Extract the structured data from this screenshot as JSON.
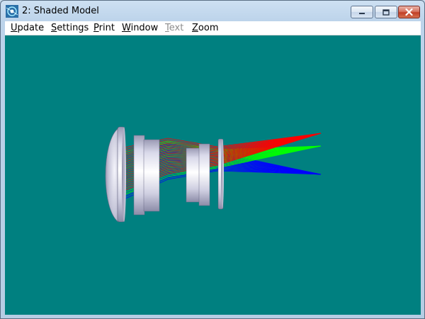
{
  "window": {
    "title": "2: Shaded Model",
    "icon": "lens-app-icon"
  },
  "menubar": {
    "items": [
      {
        "label": "Update",
        "mnemonic": "U",
        "rest": "pdate",
        "enabled": true
      },
      {
        "label": "Settings",
        "mnemonic": "S",
        "rest": "ettings",
        "enabled": true
      },
      {
        "label": "Print",
        "mnemonic": "P",
        "rest": "rint",
        "enabled": true
      },
      {
        "label": "Window",
        "mnemonic": "W",
        "rest": "indow",
        "enabled": true
      },
      {
        "label": "Text",
        "mnemonic": "T",
        "rest": "ext",
        "enabled": false
      },
      {
        "label": "Zoom",
        "mnemonic": "Z",
        "rest": "oom",
        "enabled": true
      }
    ]
  },
  "viewport": {
    "background": "#008080",
    "model": "shaded-lens-assembly",
    "ray_colors": [
      "#ff0000",
      "#00ff00",
      "#0000ff"
    ]
  }
}
